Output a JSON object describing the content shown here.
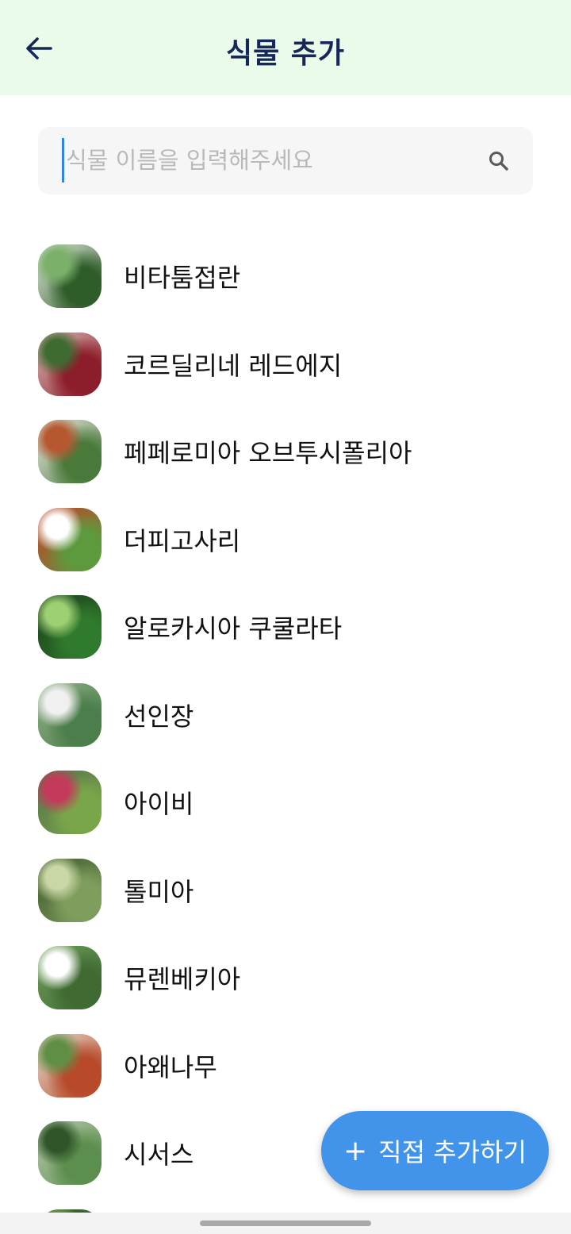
{
  "header": {
    "title": "식물 추가",
    "back_icon": "arrow-left-icon",
    "background": "#eafbe9",
    "title_color": "#17275a"
  },
  "search": {
    "value": "",
    "placeholder": "식물 이름을 입력해주세요",
    "icon": "search-icon"
  },
  "plants": [
    {
      "name": "비타툼접란",
      "thumb_colors": [
        "#2f5d2a",
        "#7bb06a",
        "#dfe8da"
      ]
    },
    {
      "name": "코르딜리네 레드에지",
      "thumb_colors": [
        "#8c1d2a",
        "#3d6b30",
        "#d9b9b5"
      ]
    },
    {
      "name": "페페로미아 오브투시폴리아",
      "thumb_colors": [
        "#4a7a3a",
        "#b5582f",
        "#e9e6e0"
      ]
    },
    {
      "name": "더피고사리",
      "thumb_colors": [
        "#5d9a3d",
        "#ffffff",
        "#c0432a"
      ]
    },
    {
      "name": "알로카시아 쿠쿨라타",
      "thumb_colors": [
        "#2f7a2c",
        "#9dcf73",
        "#1d3f1c"
      ]
    },
    {
      "name": "선인장",
      "thumb_colors": [
        "#4b7e4a",
        "#f0f0f0",
        "#8fae85"
      ]
    },
    {
      "name": "아이비",
      "thumb_colors": [
        "#7aa64a",
        "#c43a5a",
        "#55734b"
      ]
    },
    {
      "name": "톨미아",
      "thumb_colors": [
        "#7f9e5d",
        "#c9d6a5",
        "#3e5a2c"
      ]
    },
    {
      "name": "뮤렌베키아",
      "thumb_colors": [
        "#3f6b33",
        "#ffffff",
        "#6e9c59"
      ]
    },
    {
      "name": "아왜나무",
      "thumb_colors": [
        "#b84a2a",
        "#5e8f45",
        "#e3dccf"
      ]
    },
    {
      "name": "시서스",
      "thumb_colors": [
        "#5c8e4d",
        "#2f5528",
        "#b9c9ad"
      ]
    },
    {
      "name": "",
      "thumb_colors": [
        "#4f8b3c",
        "#86b35f",
        "#2d4d26"
      ]
    }
  ],
  "fab": {
    "label": "직접 추가하기",
    "plus": "+",
    "color": "#4293ea"
  }
}
